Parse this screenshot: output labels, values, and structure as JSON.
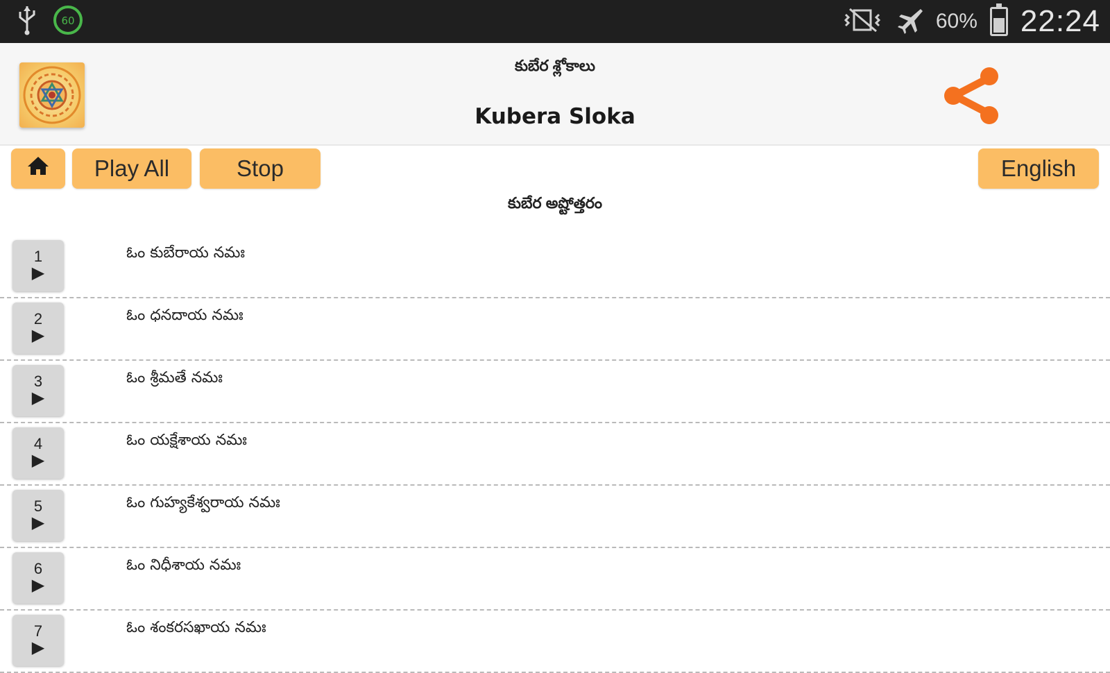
{
  "status_bar": {
    "icons": [
      "usb-icon",
      "notification-60-icon",
      "vibrate-mute-icon",
      "airplane-mode-icon",
      "battery-icon"
    ],
    "battery_percent": "60%",
    "time": "22:24"
  },
  "header": {
    "subtitle": "కుబేర శ్లోకాలు",
    "title": "Kubera Sloka",
    "share_icon_color": "#f4711f"
  },
  "toolbar": {
    "home_icon": "home-icon",
    "play_all_label": "Play All",
    "stop_label": "Stop",
    "language_label": "English",
    "button_color": "#fbbd64"
  },
  "section_title": "కుబేర అష్టోత్తరం",
  "items": [
    {
      "number": "1",
      "text": "ఓం కుబేరాయ నమః"
    },
    {
      "number": "2",
      "text": "ఓం ధనదాయ నమః"
    },
    {
      "number": "3",
      "text": "ఓం శ్రీమతే నమః"
    },
    {
      "number": "4",
      "text": "ఓం యక్షేశాయ నమః"
    },
    {
      "number": "5",
      "text": "ఓం గుహ్యకేశ్వరాయ నమః"
    },
    {
      "number": "6",
      "text": "ఓం నిధీశాయ నమః"
    },
    {
      "number": "7",
      "text": "ఓం శంకరసఖాయ నమః"
    }
  ]
}
